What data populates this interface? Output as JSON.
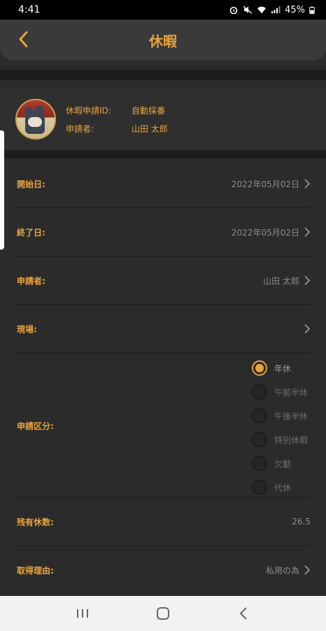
{
  "status_bar": {
    "time": "4:41",
    "battery": "45%"
  },
  "app_bar": {
    "title": "休暇"
  },
  "profile": {
    "id_label": "休暇申請ID:",
    "id_value": "自動採番",
    "applicant_label": "申請者:",
    "applicant_value": "山田 太郎"
  },
  "fields": {
    "start_date": {
      "label": "開始日:",
      "value": "2022年05月02日"
    },
    "end_date": {
      "label": "終了日:",
      "value": "2022年05月02日"
    },
    "applicant": {
      "label": "申請者:",
      "value": "山田 太郎"
    },
    "site": {
      "label": "現場:",
      "value": ""
    },
    "category": {
      "label": "申請区分:",
      "options": [
        "年休",
        "午前半休",
        "午後半休",
        "特別休暇",
        "欠勤",
        "代休"
      ],
      "selected": "年休"
    },
    "remaining": {
      "label": "残有休数:",
      "value": "26.5"
    },
    "reason": {
      "label": "取得理由:",
      "value": "私用の為"
    }
  },
  "colors": {
    "accent": "#e8a33a",
    "background": "#2b2b2b",
    "muted_text": "#8c8c8c"
  },
  "icons": [
    "back-arrow-icon",
    "chevron-right-icon",
    "recent-apps-icon",
    "home-icon",
    "nav-back-icon",
    "alarm-icon",
    "mute-icon",
    "wifi-icon",
    "signal-icon",
    "battery-icon"
  ]
}
